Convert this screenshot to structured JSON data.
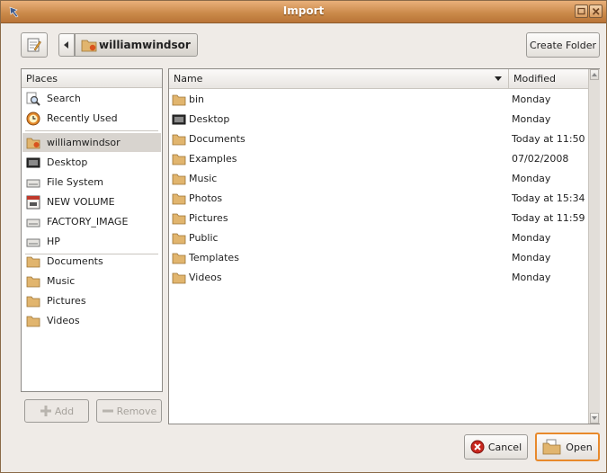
{
  "window": {
    "title": "Import"
  },
  "path": {
    "current": "williamwindsor"
  },
  "toolbar": {
    "create_folder": "Create Folder"
  },
  "places": {
    "header": "Places",
    "items": [
      {
        "label": "Search",
        "icon": "search-icon"
      },
      {
        "label": "Recently Used",
        "icon": "recent-icon"
      },
      {
        "label": "williamwindsor",
        "icon": "home-folder-icon",
        "selected": true
      },
      {
        "label": "Desktop",
        "icon": "desktop-icon"
      },
      {
        "label": "File System",
        "icon": "drive-icon"
      },
      {
        "label": "NEW VOLUME",
        "icon": "usb-drive-icon"
      },
      {
        "label": "FACTORY_IMAGE",
        "icon": "drive-icon"
      },
      {
        "label": "HP",
        "icon": "drive-icon"
      }
    ],
    "bookmarks": [
      {
        "label": "Documents",
        "icon": "folder-icon"
      },
      {
        "label": "Music",
        "icon": "folder-icon"
      },
      {
        "label": "Pictures",
        "icon": "folder-icon"
      },
      {
        "label": "Videos",
        "icon": "folder-icon"
      }
    ],
    "add_label": "Add",
    "remove_label": "Remove"
  },
  "files": {
    "col_name": "Name",
    "col_modified": "Modified",
    "rows": [
      {
        "name": "bin",
        "modified": "Monday",
        "icon": "folder-icon"
      },
      {
        "name": "Desktop",
        "modified": "Monday",
        "icon": "desktop-icon"
      },
      {
        "name": "Documents",
        "modified": "Today at 11:50",
        "icon": "folder-icon"
      },
      {
        "name": "Examples",
        "modified": "07/02/2008",
        "icon": "folder-icon"
      },
      {
        "name": "Music",
        "modified": "Monday",
        "icon": "folder-icon"
      },
      {
        "name": "Photos",
        "modified": "Today at 15:34",
        "icon": "folder-icon"
      },
      {
        "name": "Pictures",
        "modified": "Today at 11:59",
        "icon": "folder-icon"
      },
      {
        "name": "Public",
        "modified": "Monday",
        "icon": "folder-icon"
      },
      {
        "name": "Templates",
        "modified": "Monday",
        "icon": "folder-icon"
      },
      {
        "name": "Videos",
        "modified": "Monday",
        "icon": "folder-icon"
      }
    ]
  },
  "buttons": {
    "cancel": "Cancel",
    "open": "Open"
  },
  "colors": {
    "titlebar": "#c98848",
    "folder": "#d9b06a",
    "cancel_red": "#c8261d",
    "open_border": "#e8892b"
  }
}
